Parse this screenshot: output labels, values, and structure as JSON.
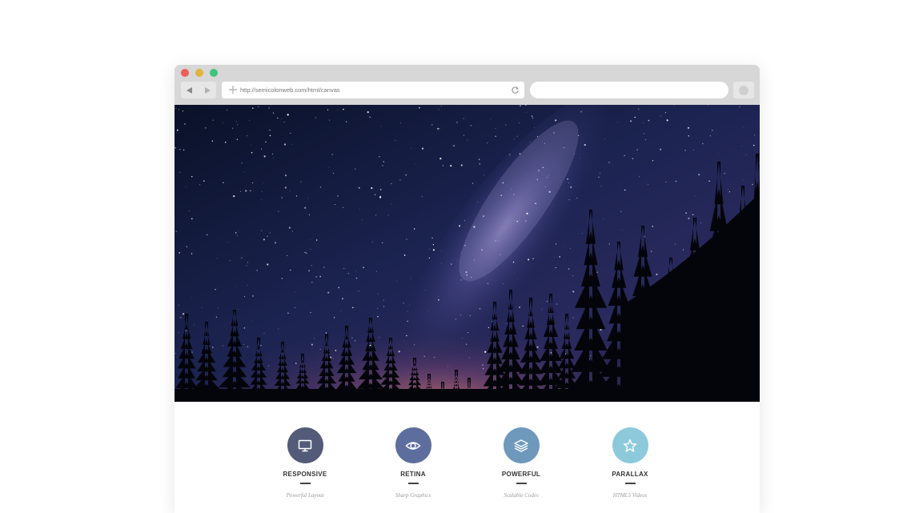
{
  "browser": {
    "url": "http://semicolonweb.com/html/canvas",
    "search_placeholder": ""
  },
  "hero": {
    "image_description_icon": "starry-night-sky-with-pine-trees"
  },
  "features": [
    {
      "title": "RESPONSIVE",
      "subtitle": "Powerful Layout",
      "icon": "monitor-icon",
      "color": "#545b78"
    },
    {
      "title": "RETINA",
      "subtitle": "Sharp Graphics",
      "icon": "eye-icon",
      "color": "#5d6e9e"
    },
    {
      "title": "POWERFUL",
      "subtitle": "Scalable Codes",
      "icon": "layers-icon",
      "color": "#6f98bd"
    },
    {
      "title": "PARALLAX",
      "subtitle": "HTML5 Videos",
      "icon": "star-icon",
      "color": "#8ccadb"
    }
  ],
  "colors": {
    "chrome_bg": "#d7d7d7",
    "dot_red": "#ed5f5b",
    "dot_yellow": "#e2b33c",
    "dot_green": "#36c77a"
  }
}
